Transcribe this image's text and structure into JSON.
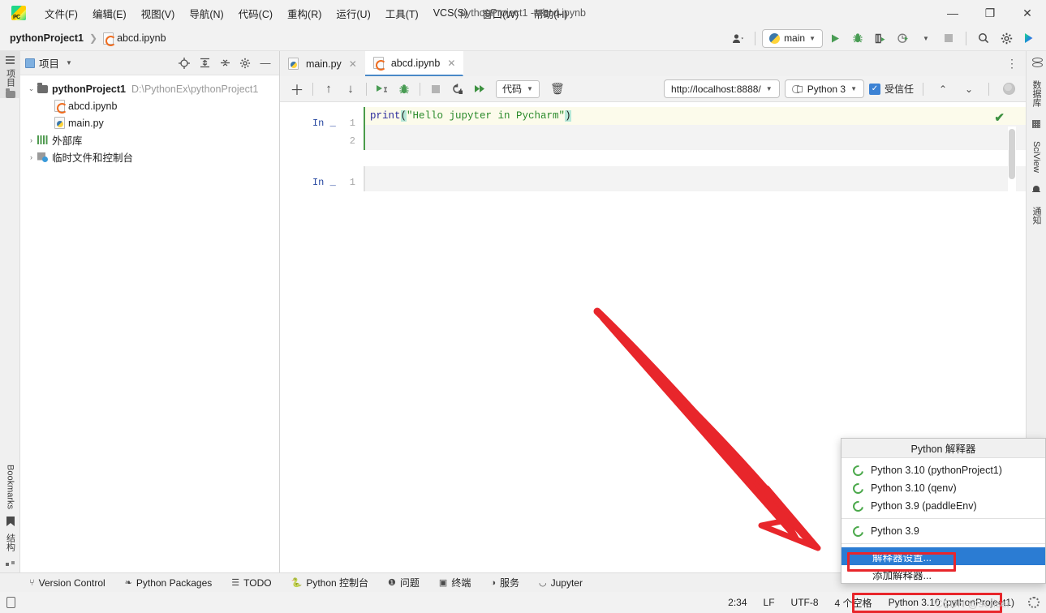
{
  "window": {
    "title": "pythonProject1 - abcd.ipynb",
    "minimize": "—",
    "maximize": "❐",
    "close": "✕"
  },
  "menu": {
    "items": [
      {
        "label": "文件(F)"
      },
      {
        "label": "编辑(E)"
      },
      {
        "label": "视图(V)"
      },
      {
        "label": "导航(N)"
      },
      {
        "label": "代码(C)"
      },
      {
        "label": "重构(R)"
      },
      {
        "label": "运行(U)"
      },
      {
        "label": "工具(T)"
      },
      {
        "label": "VCS(S)"
      },
      {
        "label": "窗口(W)"
      },
      {
        "label": "帮助(H)"
      }
    ]
  },
  "breadcrumb": {
    "project": "pythonProject1",
    "separator": "❯",
    "file": "abcd.ipynb"
  },
  "main_toolbar": {
    "account_icon": "user-icon",
    "run_config": "main",
    "run_icon": "▶",
    "debug_icon": "debug-bug-icon",
    "coverage_icon": "run-with-coverage-icon",
    "profile_icon": "profiler-icon",
    "stop_icon": "stop-icon",
    "search_icon": "🔍",
    "settings_icon": "⚙",
    "updates_icon": "ide-updates-icon"
  },
  "left_strip": {
    "project_label": "项目",
    "bookmarks_label": "Bookmarks",
    "structure_label": "结构"
  },
  "right_strip": {
    "database_label": "数据库",
    "sciview_label": "SciView",
    "notifications_label": "通知"
  },
  "project_panel": {
    "title": "项目",
    "header_icons": [
      "locate-icon",
      "expand-all-icon",
      "collapse-all-icon",
      "settings-icon",
      "hide-icon"
    ],
    "tree": [
      {
        "arrow": "⌄",
        "name": "pythonProject1",
        "path": "D:\\PythonEx\\pythonProject1",
        "type": "folder",
        "bold": true,
        "indent": 0
      },
      {
        "arrow": "",
        "name": "abcd.ipynb",
        "path": "",
        "type": "ipynb",
        "bold": false,
        "indent": 1
      },
      {
        "arrow": "",
        "name": "main.py",
        "path": "",
        "type": "py",
        "bold": false,
        "indent": 1
      },
      {
        "arrow": "›",
        "name": "外部库",
        "path": "",
        "type": "library",
        "bold": false,
        "indent": 0
      },
      {
        "arrow": "›",
        "name": "临时文件和控制台",
        "path": "",
        "type": "scratch",
        "bold": false,
        "indent": 0
      }
    ]
  },
  "editor": {
    "tabs": [
      {
        "label": "main.py",
        "type": "py",
        "active": false,
        "close": "✕"
      },
      {
        "label": "abcd.ipynb",
        "type": "ipynb",
        "active": true,
        "close": "✕"
      }
    ],
    "more_icon": "⋮",
    "notebook_toolbar": {
      "add_cell": "＋",
      "move_up": "↑",
      "move_down": "↓",
      "run_cell": "run-cell-icon",
      "debug_cell": "debug-cell-icon",
      "interrupt": "interrupt-kernel-icon",
      "restart": "restart-kernel-icon",
      "run_all": "run-all-cells-icon",
      "cell_type": "代码",
      "delete_cell": "🗑",
      "server_url": "http://localhost:8888/",
      "kernel": "Python 3",
      "trusted_label": "受信任",
      "trusted_checked": true,
      "prev_cell": "⌃",
      "next_cell": "⌄",
      "browser_icon": "open-in-browser-icon"
    },
    "cells": [
      {
        "prompt": "In _",
        "lines": [
          {
            "num": "1",
            "code": "print(\"Hello jupyter in Pycharm\")"
          },
          {
            "num": "2",
            "code": ""
          }
        ],
        "status": "✔"
      },
      {
        "prompt": "In _",
        "lines": [
          {
            "num": "1",
            "code": ""
          }
        ],
        "status": ""
      }
    ]
  },
  "bottom_bar": {
    "items": [
      {
        "label": "Version Control",
        "icon": "branch-icon"
      },
      {
        "label": "Python Packages",
        "icon": "packages-icon"
      },
      {
        "label": "TODO",
        "icon": "todo-list-icon"
      },
      {
        "label": "Python 控制台",
        "icon": "python-console-icon"
      },
      {
        "label": "问题",
        "icon": "problems-icon"
      },
      {
        "label": "终端",
        "icon": "terminal-icon"
      },
      {
        "label": "服务",
        "icon": "services-icon"
      },
      {
        "label": "Jupyter",
        "icon": "jupyter-icon"
      }
    ]
  },
  "status_bar": {
    "left_icon": "mobile-preview-icon",
    "caret_position": "2:34",
    "line_separator": "LF",
    "encoding": "UTF-8",
    "indent": "4 个空格",
    "interpreter": "Python 3.10 (pythonProject1)",
    "settings_icon": "⚙"
  },
  "interpreter_popup": {
    "title": "Python 解释器",
    "items": [
      {
        "label": "Python 3.10 (pythonProject1)",
        "has_icon": true,
        "selected": false
      },
      {
        "label": "Python 3.10 (qenv)",
        "has_icon": true,
        "selected": false
      },
      {
        "label": "Python 3.9 (paddleEnv)",
        "has_icon": true,
        "selected": false
      },
      {
        "label": "Python 3.9",
        "has_icon": true,
        "selected": false,
        "group_break": true
      },
      {
        "label": "解释器设置...",
        "has_icon": false,
        "selected": true,
        "group_break": true
      },
      {
        "label": "添加解释器...",
        "has_icon": false,
        "selected": false
      }
    ]
  },
  "annotations": {
    "watermark": "CSDN @seriser",
    "arrow_color": "#e8262b",
    "box_color": "#e8262b"
  },
  "colors": {
    "accent_blue": "#2b7cd3",
    "green_run": "#499c54",
    "red_annotation": "#e8262b",
    "panel_bg": "#f0f0f0",
    "editor_bg": "#ffffff"
  }
}
